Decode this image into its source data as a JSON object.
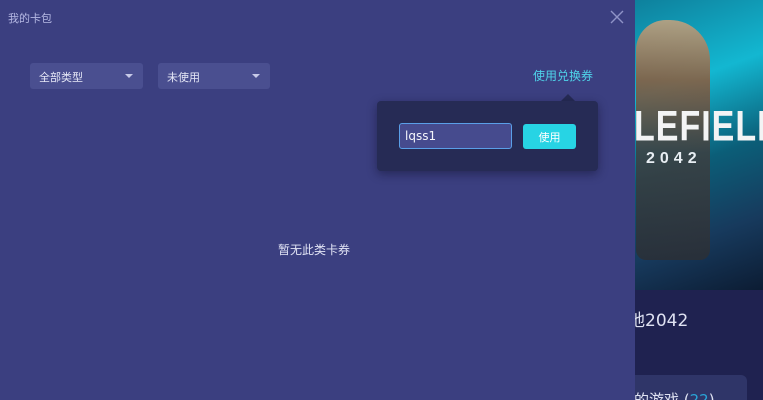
{
  "background_page": {
    "cover": {
      "title_text": "LEFIELD",
      "subtitle_text": "2042"
    },
    "game_name": "地2042",
    "section_label": "的游戏",
    "section_count": "22"
  },
  "modal": {
    "title": "我的卡包",
    "filters": {
      "type_select": {
        "value": "全部类型"
      },
      "status_select": {
        "value": "未使用"
      }
    },
    "redeem_link": "使用兑换券",
    "redeem_popover": {
      "code_input": {
        "value": "lqss1",
        "placeholder": ""
      },
      "use_button": "使用"
    },
    "empty_message": "暂无此类卡券"
  },
  "colors": {
    "modal_bg": "#3b3f80",
    "accent": "#27d4e4",
    "link": "#4fd3e9"
  }
}
